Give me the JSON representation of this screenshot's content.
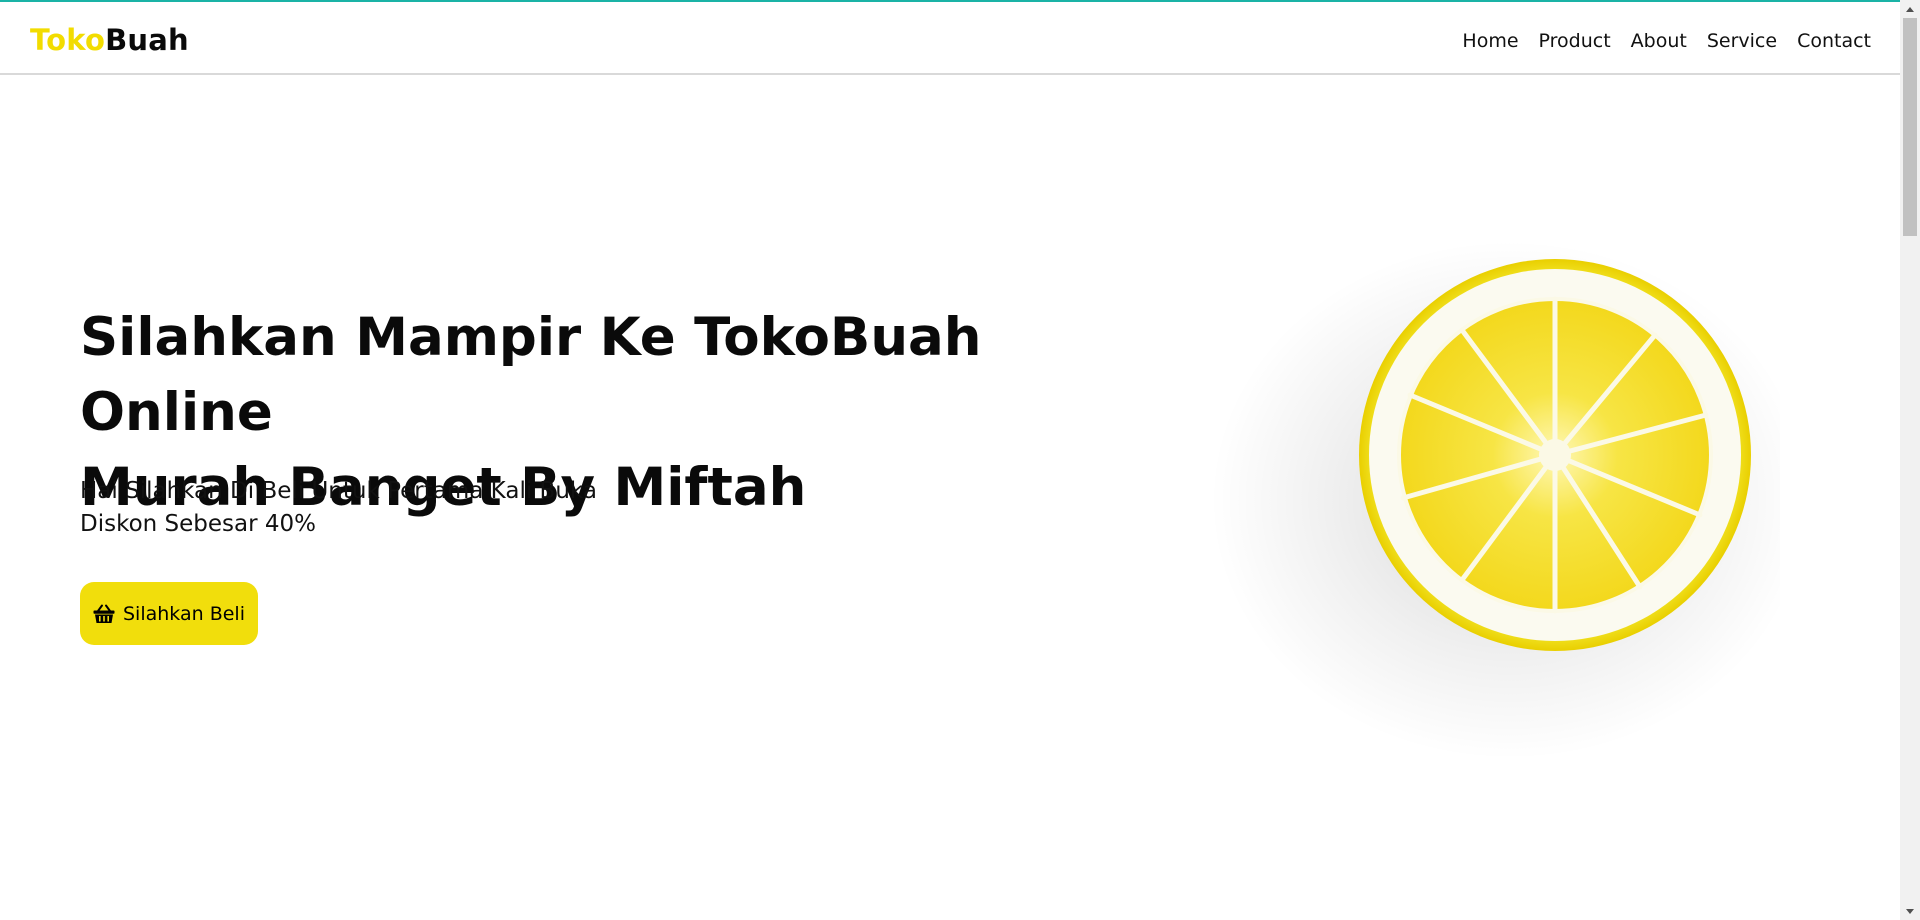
{
  "brand": {
    "part1": "Toko",
    "part2": "Buah"
  },
  "nav": {
    "items": [
      {
        "label": "Home"
      },
      {
        "label": "Product"
      },
      {
        "label": "About"
      },
      {
        "label": "Service"
      },
      {
        "label": "Contact"
      }
    ]
  },
  "hero": {
    "title_line1": "Silahkan Mampir Ke TokoBuah Online",
    "title_line2": "Murah Banget By Miftah",
    "subtitle_line1": "Hai Silahkan Di Beli Untuk Pertama Kali Buka",
    "subtitle_line2": "Diskon Sebesar 40%",
    "cta_label": "Silahkan Beli",
    "cta_icon": "basket-icon",
    "image": "lemon-slice"
  },
  "colors": {
    "accent_top": "#1ab3a6",
    "brand_yellow": "#f2dc00",
    "cta_yellow": "#f1de0c",
    "text": "#0a0a0a"
  }
}
